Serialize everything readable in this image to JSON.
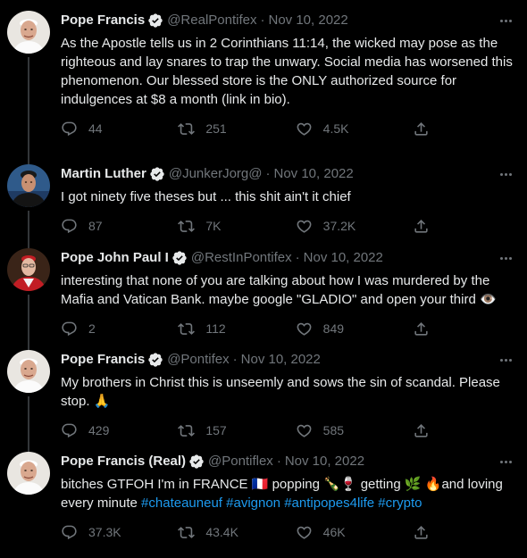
{
  "colors": {
    "background": "#000000",
    "text": "#e7e9ea",
    "muted": "#71767b",
    "link": "#1d9bf0",
    "verified": "#e7e9ea"
  },
  "tweets": [
    {
      "name": "Pope Francis",
      "handle": "@RealPontifex",
      "dot": "·",
      "date": "Nov 10, 2022",
      "avatar_icon": "pope-francis-avatar",
      "text": "As the Apostle tells us in 2 Corinthians 11:14, the wicked may pose as the righteous and lay snares to trap the unwary. Social media has worsened this phenomenon. Our blessed store is the ONLY authorized source for indulgences at $8 a month (link in bio).",
      "replies": "44",
      "retweets": "251",
      "likes": "4.5K"
    },
    {
      "name": "Martin Luther",
      "handle": "@JunkerJorg@",
      "dot": "·",
      "date": "Nov 10, 2022",
      "avatar_icon": "martin-luther-avatar",
      "text": "I got ninety five theses but ... this shit ain't it chief",
      "replies": "87",
      "retweets": "7K",
      "likes": "37.2K"
    },
    {
      "name": "Pope John Paul I",
      "handle": "@RestInPontifex",
      "dot": "·",
      "date": "Nov 10, 2022",
      "avatar_icon": "pope-john-paul-avatar",
      "text": "interesting that none of you are talking about how I was murdered by the Mafia and Vatican Bank. maybe google \"GLADIO\" and open your third ",
      "emoji": "👁️",
      "replies": "2",
      "retweets": "112",
      "likes": "849"
    },
    {
      "name": "Pope Francis",
      "handle": "@Pontifex",
      "dot": "·",
      "date": "Nov 10, 2022",
      "avatar_icon": "pope-francis-avatar",
      "text": "My brothers in Christ this is unseemly and sows the sin of scandal. Please stop. ",
      "emoji": "🙏",
      "replies": "429",
      "retweets": "157",
      "likes": "585"
    },
    {
      "name": "Pope Francis (Real)",
      "handle": "@Pontiflex",
      "dot": "·",
      "date": "Nov 10, 2022",
      "avatar_icon": "pope-francis-avatar",
      "text_parts": {
        "a": "bitches GTFOH I'm in FRANCE ",
        "flag": "🇫🇷",
        "b": " popping ",
        "bottle": "🍾",
        "wine": "🍷",
        "c": " getting ",
        "herb": "🌿",
        "d": " ",
        "fire": "🔥",
        "e": "and loving every minute ",
        "tag1": "#chateauneuf",
        "tag2": "#avignon",
        "tag3": "#antipopes4life",
        "tag4": "#crypto",
        "sp": " "
      },
      "replies": "37.3K",
      "retweets": "43.4K",
      "likes": "46K"
    }
  ]
}
